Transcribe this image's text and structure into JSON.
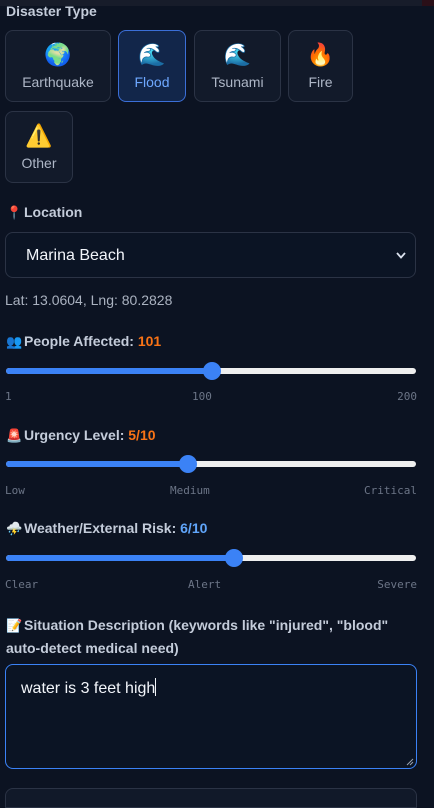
{
  "disaster_type": {
    "title": "Disaster Type",
    "options": [
      {
        "label": "Earthquake",
        "icon": "globe-icon",
        "glyph": "🌍",
        "selected": false
      },
      {
        "label": "Flood",
        "icon": "wave-icon",
        "glyph": "🌊",
        "selected": true
      },
      {
        "label": "Tsunami",
        "icon": "wave-icon",
        "glyph": "🌊",
        "selected": false
      },
      {
        "label": "Fire",
        "icon": "fire-icon",
        "glyph": "🔥",
        "selected": false
      },
      {
        "label": "Other",
        "icon": "warning-icon",
        "glyph": "⚠️",
        "selected": false
      }
    ]
  },
  "location": {
    "label": "Location",
    "icon": "pin-icon",
    "glyph": "📍",
    "selected": "Marina Beach",
    "coords": "Lat: 13.0604, Lng: 80.2828"
  },
  "people": {
    "label": "People Affected:",
    "value": "101",
    "glyph": "👥",
    "min": 1,
    "max": 200,
    "current": 101,
    "scale": [
      "1",
      "100",
      "200"
    ]
  },
  "urgency": {
    "label": "Urgency Level:",
    "value": "5/10",
    "glyph": "🚨",
    "min": 1,
    "max": 10,
    "current": 5,
    "scale": [
      "Low",
      "Medium",
      "Critical"
    ]
  },
  "weather": {
    "label": "Weather/External Risk:",
    "value": "6/10",
    "glyph": "⛈️",
    "min": 1,
    "max": 10,
    "current": 6,
    "scale": [
      "Clear",
      "Alert",
      "Severe"
    ]
  },
  "description": {
    "label": "Situation Description (keywords like \"injured\", \"blood\" auto-detect medical need)",
    "glyph": "📝",
    "value": "water is 3 feet high"
  },
  "colors": {
    "accent": "#3b82f6",
    "people_value": "#f97316",
    "urgency_value": "#f97316",
    "weather_value": "#60a5fa"
  }
}
